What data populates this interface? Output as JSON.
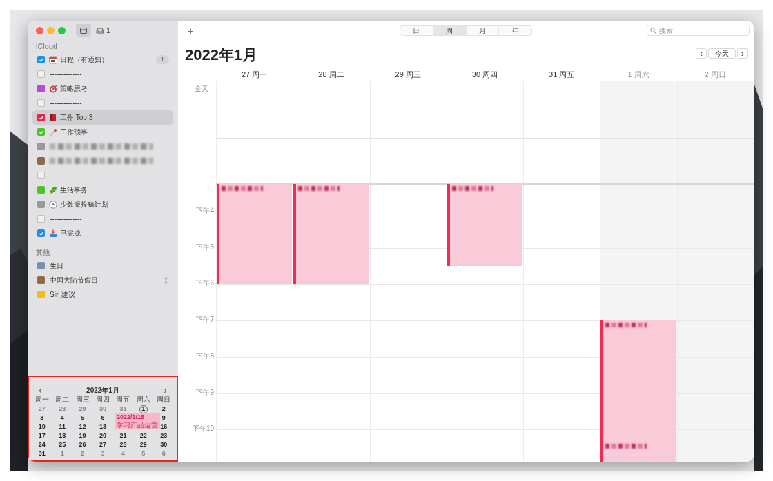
{
  "toolbar": {
    "inbox_count": "1",
    "add": "+",
    "views": [
      {
        "label": "日",
        "selected": false
      },
      {
        "label": "周",
        "selected": true
      },
      {
        "label": "月",
        "selected": false
      },
      {
        "label": "年",
        "selected": false
      }
    ],
    "search": {
      "placeholder": "搜索"
    }
  },
  "sidebar": {
    "sections": [
      {
        "title": "iCloud",
        "items": [
          {
            "label": "日程（有通知）",
            "color": "#1c8ef2",
            "checked": true,
            "badge": "1",
            "selected": false
          },
          {
            "label": "--------------",
            "checked": false,
            "selected": false
          },
          {
            "label": "策略思考",
            "color": "#b54bd6",
            "checked": false,
            "selected": false
          },
          {
            "label": "--------------",
            "checked": false,
            "selected": false
          },
          {
            "label": "工作 Top 3",
            "color": "#e8234a",
            "checked": true,
            "selected": true
          },
          {
            "label": "工作琐事",
            "color": "#4cc32a",
            "checked": true,
            "selected": false
          },
          {
            "kind": "obscured",
            "color": "#9a9a9a",
            "checked": false,
            "selected": false
          },
          {
            "kind": "obscured",
            "color": "#8b6a45",
            "checked": false,
            "selected": false
          },
          {
            "label": "--------------",
            "checked": false,
            "selected": false
          },
          {
            "label": "生活事务",
            "color": "#4cc32a",
            "checked": false,
            "selected": false
          },
          {
            "label": "少数派投稿计划",
            "color": "#9a9a9a",
            "checked": false,
            "selected": false
          },
          {
            "label": "--------------",
            "checked": false,
            "selected": false
          },
          {
            "label": "已完成",
            "color": "#1c8ef2",
            "checked": true,
            "selected": false
          }
        ]
      },
      {
        "title": "其他",
        "items": [
          {
            "label": "生日",
            "color": "#7d8fae",
            "checked": false,
            "selected": false
          },
          {
            "label": "中国大陆节假日",
            "color": "#8b6a45",
            "checked": false,
            "selected": false,
            "subscribed": true
          },
          {
            "label": "Siri 建议",
            "color": "#f5bd11",
            "checked": false,
            "selected": false
          }
        ]
      }
    ]
  },
  "mini_calendar": {
    "title": "2022年1月",
    "prev": "‹",
    "next": "›",
    "weekdays": [
      "周一",
      "周二",
      "周三",
      "周四",
      "周五",
      "周六",
      "周日"
    ],
    "weeks": [
      [
        {
          "day": "27",
          "muted": true
        },
        {
          "day": "28",
          "muted": true
        },
        {
          "day": "29",
          "muted": true
        },
        {
          "day": "30",
          "muted": true
        },
        {
          "day": "31",
          "muted": true
        },
        {
          "day": "1",
          "muted": false,
          "today": true
        },
        {
          "day": "2",
          "muted": false
        }
      ],
      [
        {
          "day": "3",
          "muted": false
        },
        {
          "day": "4",
          "muted": false
        },
        {
          "day": "5",
          "muted": false
        },
        {
          "day": "6",
          "muted": false
        },
        {
          "covered": true
        },
        {
          "covered": true
        },
        {
          "day": "9",
          "muted": false
        }
      ],
      [
        {
          "day": "10",
          "muted": false
        },
        {
          "day": "11",
          "muted": false
        },
        {
          "day": "12",
          "muted": false
        },
        {
          "day": "13",
          "muted": false
        },
        {
          "covered": true
        },
        {
          "covered": true
        },
        {
          "day": "16",
          "muted": false
        }
      ],
      [
        {
          "day": "17",
          "muted": false
        },
        {
          "day": "18",
          "muted": false
        },
        {
          "day": "19",
          "muted": false
        },
        {
          "day": "20",
          "muted": false
        },
        {
          "day": "21",
          "muted": false
        },
        {
          "day": "22",
          "muted": false
        },
        {
          "day": "23",
          "muted": false
        }
      ],
      [
        {
          "day": "24",
          "muted": false
        },
        {
          "day": "25",
          "muted": false
        },
        {
          "day": "26",
          "muted": false
        },
        {
          "day": "27",
          "muted": false
        },
        {
          "day": "28",
          "muted": false
        },
        {
          "day": "29",
          "muted": false
        },
        {
          "day": "30",
          "muted": false
        }
      ],
      [
        {
          "day": "31",
          "muted": false
        },
        {
          "day": "1",
          "muted": true
        },
        {
          "day": "2",
          "muted": true
        },
        {
          "day": "3",
          "muted": true
        },
        {
          "day": "4",
          "muted": true
        },
        {
          "day": "5",
          "muted": true
        },
        {
          "day": "6",
          "muted": true
        }
      ]
    ],
    "tooltip": {
      "date": "2022/1/18",
      "title": "学习产品运营"
    }
  },
  "week_view": {
    "title": "2022年1月",
    "prev": "‹",
    "today": "今天",
    "next": "›",
    "all_day": "全天",
    "hours": [
      "下午4",
      "下午5",
      "下午6",
      "下午7",
      "下午8",
      "下午9",
      "下午10"
    ],
    "days": [
      {
        "label": "27 周一",
        "muted": false,
        "events": [
          {
            "kind": "timed"
          }
        ]
      },
      {
        "label": "28 周二",
        "muted": false,
        "events": [
          {
            "kind": "timed"
          }
        ]
      },
      {
        "label": "29 周三",
        "muted": false
      },
      {
        "label": "30 周四",
        "muted": false,
        "events": [
          {
            "kind": "timed"
          }
        ]
      },
      {
        "label": "31 周五",
        "muted": false
      },
      {
        "label": "1 周六",
        "muted": true,
        "events": [
          {
            "kind": "timed"
          },
          {
            "kind": "timed"
          }
        ]
      },
      {
        "label": "2 周日",
        "muted": true
      }
    ]
  }
}
